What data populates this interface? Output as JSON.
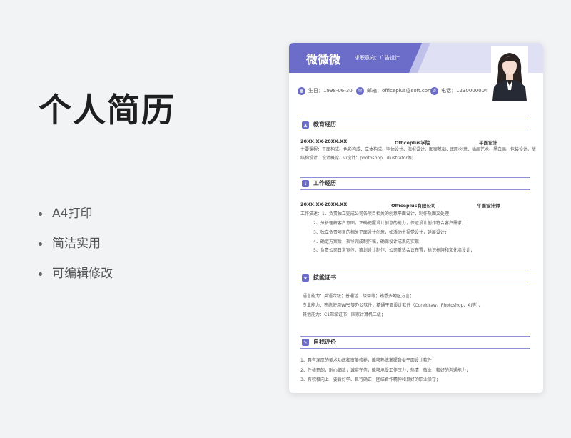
{
  "left": {
    "title": "个人简历",
    "features": [
      "A4打印",
      "简洁实用",
      "可编辑修改"
    ]
  },
  "resume": {
    "name": "微微微",
    "target": "求职意向：广告设计",
    "birth": "生日：1998-06-30",
    "email": "邮箱：officeplus@soft.com",
    "phone": "电话：1230000004",
    "education": {
      "title": "教育经历",
      "date": "20XX.XX-20XX.XX",
      "school": "Officeplus学院",
      "major": "平面设计",
      "courses_1": "主要课程：平面构成、色彩构成、立体构成、字体设计、海报设计、图案基础、图形创意、插画艺术、黑白画、包装设计、版",
      "courses_2": "结构设计、设计概论、vi设计：photoshop、illustrator等;"
    },
    "work": {
      "title": "工作经历",
      "date": "20XX.XX-20XX.XX",
      "company": "Officeplus有限公司",
      "position": "平面设计师",
      "lines": [
        "工作描述：1、负责独立完成公司各项目相关的创意平面设计，制作及图文处理；",
        "2、分析理解客户意图，正确把握设计创意的能力，保证设计创作符合客户需求；",
        "3、独立负责项目的相关平面设计创意，如活动主视觉设计，延展设计；",
        "4、确定方案后，指导完成制作稿，确保设计成果的实现；",
        "5、负责公司日常宣传、策划设计制作、公司重适会议布置，标识标牌和文化墙设计；"
      ]
    },
    "skills": {
      "title": "技能证书",
      "lines": [
        "语言能力：英语六级；普通话二级甲等；熟悉多地区方言；",
        "专业能力：熟练使用WPS等办公软件；精通平面设计软件（Coreldraw、Photoshop、AI等）；",
        "其他能力：C1驾驶证书；国家计算机二级；"
      ]
    },
    "self": {
      "title": "自我评价",
      "lines": [
        "1、具有深厚的美术功底和审美修养，能够熟练掌握各类平面设计软件；",
        "2、性格开朗，耐心细致，诚实守信，能够承受工作压力；热情，敬业，较好的沟通能力；",
        "3、有积极向上，要肯好学、且行确正，团结合作精神和良好的职业操守；"
      ]
    }
  },
  "colors": {
    "accent": "#6b6dc9",
    "accent_light": "#dfe0f3",
    "background": "#f2f3f5"
  }
}
